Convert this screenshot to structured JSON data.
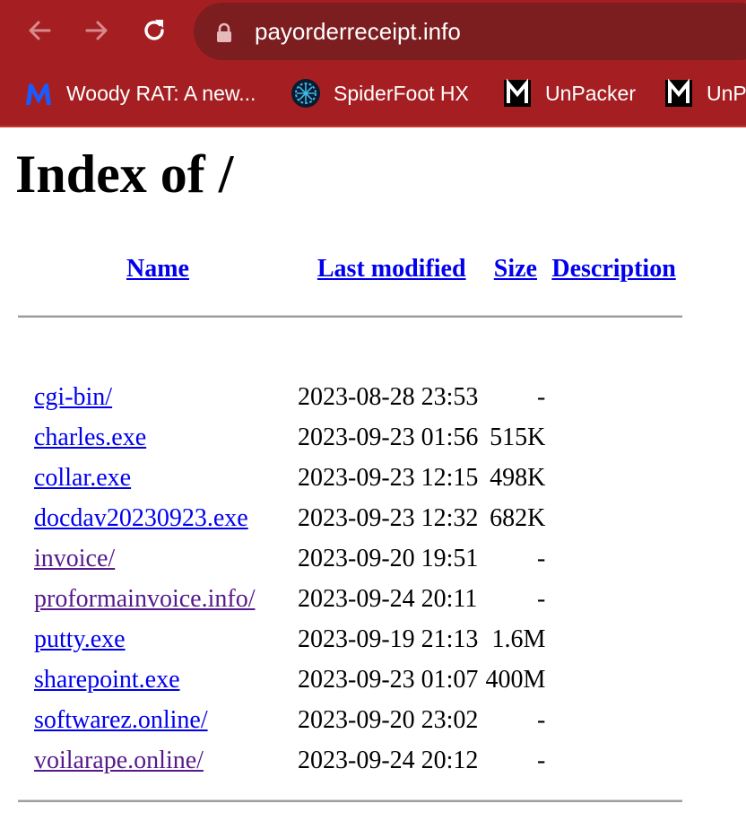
{
  "browser": {
    "url": "payorderreceipt.info",
    "bookmarks": [
      {
        "label": "Woody RAT: A new...",
        "icon": "malwarebytes-icon"
      },
      {
        "label": "SpiderFoot HX",
        "icon": "spiderfoot-icon"
      },
      {
        "label": "UnPacker",
        "icon": "unpacker-m-icon"
      },
      {
        "label": "UnP",
        "icon": "unpacker-m-icon"
      }
    ]
  },
  "page": {
    "title": "Index of /",
    "columns": {
      "name": "Name",
      "last_modified": "Last modified",
      "size": "Size",
      "description": "Description"
    },
    "rows": [
      {
        "name": "cgi-bin/",
        "modified": "2023-08-28 23:53",
        "size": "-",
        "visited": false
      },
      {
        "name": "charles.exe",
        "modified": "2023-09-23 01:56",
        "size": "515K",
        "visited": false
      },
      {
        "name": "collar.exe",
        "modified": "2023-09-23 12:15",
        "size": "498K",
        "visited": false
      },
      {
        "name": "docdav20230923.exe",
        "modified": "2023-09-23 12:32",
        "size": "682K",
        "visited": false
      },
      {
        "name": "invoice/",
        "modified": "2023-09-20 19:51",
        "size": "-",
        "visited": true
      },
      {
        "name": "proformainvoice.info/",
        "modified": "2023-09-24 20:11",
        "size": "-",
        "visited": true
      },
      {
        "name": "putty.exe",
        "modified": "2023-09-19 21:13",
        "size": "1.6M",
        "visited": false
      },
      {
        "name": "sharepoint.exe",
        "modified": "2023-09-23 01:07",
        "size": "400M",
        "visited": false
      },
      {
        "name": "softwarez.online/",
        "modified": "2023-09-20 23:02",
        "size": "-",
        "visited": false
      },
      {
        "name": "voilarape.online/",
        "modified": "2023-09-24 20:12",
        "size": "-",
        "visited": true
      }
    ]
  },
  "colors": {
    "chrome": "#a51f22",
    "omnibox": "#7c1d20",
    "link": "#0000ee",
    "visited_link": "#551a8b"
  }
}
